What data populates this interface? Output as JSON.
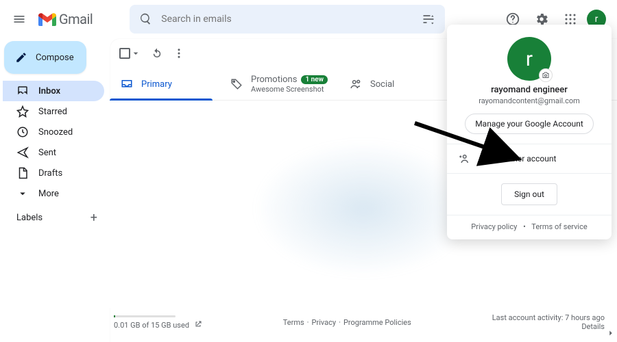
{
  "header": {
    "logo_text": "Gmail",
    "search_placeholder": "Search in emails",
    "avatar_initial": "r"
  },
  "sidebar": {
    "compose_label": "Compose",
    "items": [
      "Inbox",
      "Starred",
      "Snoozed",
      "Sent",
      "Drafts",
      "More"
    ],
    "labels_heading": "Labels"
  },
  "tabs": {
    "primary": "Primary",
    "promotions": "Promotions",
    "promotions_badge": "1 new",
    "promotions_sub": "Awesome Screenshot",
    "social": "Social"
  },
  "footer": {
    "storage": "0.01 GB of 15 GB used",
    "center_links": [
      "Terms",
      "Privacy",
      "Programme Policies"
    ],
    "activity": "Last account activity: 7 hours ago",
    "details": "Details"
  },
  "account_popover": {
    "avatar_initial": "r",
    "name": "rayomand engineer",
    "email": "rayomandcontent@gmail.com",
    "manage_label": "Manage your Google Account",
    "add_account_label": "Add another account",
    "signout_label": "Sign out",
    "privacy": "Privacy policy",
    "terms": "Terms of service"
  }
}
